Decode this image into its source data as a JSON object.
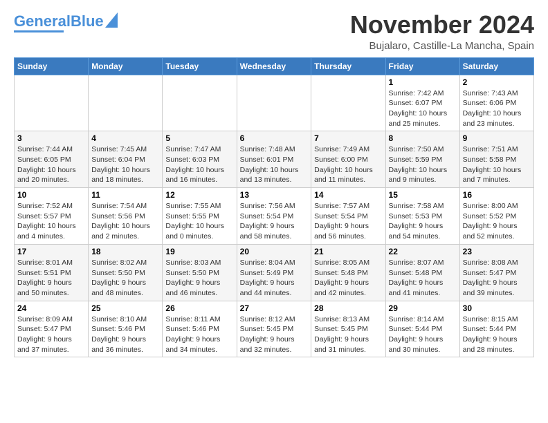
{
  "logo": {
    "part1": "General",
    "part2": "Blue"
  },
  "header": {
    "month": "November 2024",
    "location": "Bujalaro, Castille-La Mancha, Spain"
  },
  "weekdays": [
    "Sunday",
    "Monday",
    "Tuesday",
    "Wednesday",
    "Thursday",
    "Friday",
    "Saturday"
  ],
  "weeks": [
    [
      {
        "day": "",
        "info": ""
      },
      {
        "day": "",
        "info": ""
      },
      {
        "day": "",
        "info": ""
      },
      {
        "day": "",
        "info": ""
      },
      {
        "day": "",
        "info": ""
      },
      {
        "day": "1",
        "info": "Sunrise: 7:42 AM\nSunset: 6:07 PM\nDaylight: 10 hours and 25 minutes."
      },
      {
        "day": "2",
        "info": "Sunrise: 7:43 AM\nSunset: 6:06 PM\nDaylight: 10 hours and 23 minutes."
      }
    ],
    [
      {
        "day": "3",
        "info": "Sunrise: 7:44 AM\nSunset: 6:05 PM\nDaylight: 10 hours and 20 minutes."
      },
      {
        "day": "4",
        "info": "Sunrise: 7:45 AM\nSunset: 6:04 PM\nDaylight: 10 hours and 18 minutes."
      },
      {
        "day": "5",
        "info": "Sunrise: 7:47 AM\nSunset: 6:03 PM\nDaylight: 10 hours and 16 minutes."
      },
      {
        "day": "6",
        "info": "Sunrise: 7:48 AM\nSunset: 6:01 PM\nDaylight: 10 hours and 13 minutes."
      },
      {
        "day": "7",
        "info": "Sunrise: 7:49 AM\nSunset: 6:00 PM\nDaylight: 10 hours and 11 minutes."
      },
      {
        "day": "8",
        "info": "Sunrise: 7:50 AM\nSunset: 5:59 PM\nDaylight: 10 hours and 9 minutes."
      },
      {
        "day": "9",
        "info": "Sunrise: 7:51 AM\nSunset: 5:58 PM\nDaylight: 10 hours and 7 minutes."
      }
    ],
    [
      {
        "day": "10",
        "info": "Sunrise: 7:52 AM\nSunset: 5:57 PM\nDaylight: 10 hours and 4 minutes."
      },
      {
        "day": "11",
        "info": "Sunrise: 7:54 AM\nSunset: 5:56 PM\nDaylight: 10 hours and 2 minutes."
      },
      {
        "day": "12",
        "info": "Sunrise: 7:55 AM\nSunset: 5:55 PM\nDaylight: 10 hours and 0 minutes."
      },
      {
        "day": "13",
        "info": "Sunrise: 7:56 AM\nSunset: 5:54 PM\nDaylight: 9 hours and 58 minutes."
      },
      {
        "day": "14",
        "info": "Sunrise: 7:57 AM\nSunset: 5:54 PM\nDaylight: 9 hours and 56 minutes."
      },
      {
        "day": "15",
        "info": "Sunrise: 7:58 AM\nSunset: 5:53 PM\nDaylight: 9 hours and 54 minutes."
      },
      {
        "day": "16",
        "info": "Sunrise: 8:00 AM\nSunset: 5:52 PM\nDaylight: 9 hours and 52 minutes."
      }
    ],
    [
      {
        "day": "17",
        "info": "Sunrise: 8:01 AM\nSunset: 5:51 PM\nDaylight: 9 hours and 50 minutes."
      },
      {
        "day": "18",
        "info": "Sunrise: 8:02 AM\nSunset: 5:50 PM\nDaylight: 9 hours and 48 minutes."
      },
      {
        "day": "19",
        "info": "Sunrise: 8:03 AM\nSunset: 5:50 PM\nDaylight: 9 hours and 46 minutes."
      },
      {
        "day": "20",
        "info": "Sunrise: 8:04 AM\nSunset: 5:49 PM\nDaylight: 9 hours and 44 minutes."
      },
      {
        "day": "21",
        "info": "Sunrise: 8:05 AM\nSunset: 5:48 PM\nDaylight: 9 hours and 42 minutes."
      },
      {
        "day": "22",
        "info": "Sunrise: 8:07 AM\nSunset: 5:48 PM\nDaylight: 9 hours and 41 minutes."
      },
      {
        "day": "23",
        "info": "Sunrise: 8:08 AM\nSunset: 5:47 PM\nDaylight: 9 hours and 39 minutes."
      }
    ],
    [
      {
        "day": "24",
        "info": "Sunrise: 8:09 AM\nSunset: 5:47 PM\nDaylight: 9 hours and 37 minutes."
      },
      {
        "day": "25",
        "info": "Sunrise: 8:10 AM\nSunset: 5:46 PM\nDaylight: 9 hours and 36 minutes."
      },
      {
        "day": "26",
        "info": "Sunrise: 8:11 AM\nSunset: 5:46 PM\nDaylight: 9 hours and 34 minutes."
      },
      {
        "day": "27",
        "info": "Sunrise: 8:12 AM\nSunset: 5:45 PM\nDaylight: 9 hours and 32 minutes."
      },
      {
        "day": "28",
        "info": "Sunrise: 8:13 AM\nSunset: 5:45 PM\nDaylight: 9 hours and 31 minutes."
      },
      {
        "day": "29",
        "info": "Sunrise: 8:14 AM\nSunset: 5:44 PM\nDaylight: 9 hours and 30 minutes."
      },
      {
        "day": "30",
        "info": "Sunrise: 8:15 AM\nSunset: 5:44 PM\nDaylight: 9 hours and 28 minutes."
      }
    ]
  ]
}
